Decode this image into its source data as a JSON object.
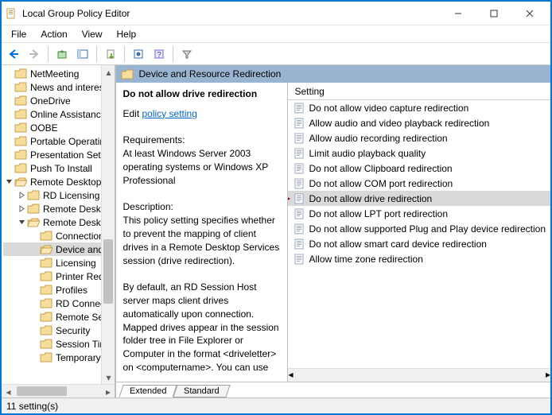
{
  "window": {
    "title": "Local Group Policy Editor"
  },
  "menu": {
    "file": "File",
    "action": "Action",
    "view": "View",
    "help": "Help"
  },
  "group_header": "Device and Resource Redirection",
  "desc": {
    "name": "Do not allow drive redirection",
    "edit_prefix": "Edit ",
    "edit_link": "policy setting ",
    "req_h": "Requirements:",
    "req_body": "At least Windows Server 2003 operating systems or Windows XP Professional",
    "desc_h": "Description:",
    "desc_body1": "This policy setting specifies whether to prevent the mapping of client drives in a Remote Desktop Services session (drive redirection).",
    "desc_body2": "By default, an RD Session Host server maps client drives automatically upon connection. Mapped drives appear in the session folder tree in File Explorer or Computer in the format <driveletter> on <computername>. You can use"
  },
  "list_header": "Setting",
  "settings": [
    "Do not allow video capture redirection",
    "Allow audio and video playback redirection",
    "Allow audio recording redirection",
    "Limit audio playback quality",
    "Do not allow Clipboard redirection",
    "Do not allow COM port redirection",
    "Do not allow drive redirection",
    "Do not allow LPT port redirection",
    "Do not allow supported Plug and Play device redirection",
    "Do not allow smart card device redirection",
    "Allow time zone redirection"
  ],
  "selected_setting_index": 6,
  "tree": [
    {
      "d": 5,
      "e": "",
      "l": "NetMeeting"
    },
    {
      "d": 5,
      "e": "",
      "l": "News and interests"
    },
    {
      "d": 5,
      "e": "",
      "l": "OneDrive"
    },
    {
      "d": 5,
      "e": "",
      "l": "Online Assistance"
    },
    {
      "d": 5,
      "e": "",
      "l": "OOBE"
    },
    {
      "d": 5,
      "e": "",
      "l": "Portable Operating System"
    },
    {
      "d": 5,
      "e": "",
      "l": "Presentation Settings"
    },
    {
      "d": 5,
      "e": "",
      "l": "Push To Install"
    },
    {
      "d": 5,
      "e": "v",
      "l": "Remote Desktop Services"
    },
    {
      "d": 6,
      "e": ">",
      "l": "RD Licensing"
    },
    {
      "d": 6,
      "e": ">",
      "l": "Remote Desktop Connection Client"
    },
    {
      "d": 6,
      "e": "v",
      "l": "Remote Desktop Session Host"
    },
    {
      "d": 7,
      "e": "",
      "l": "Connections"
    },
    {
      "d": 7,
      "e": "",
      "l": "Device and Resource Redirection",
      "sel": true
    },
    {
      "d": 7,
      "e": "",
      "l": "Licensing"
    },
    {
      "d": 7,
      "e": "",
      "l": "Printer Redirection"
    },
    {
      "d": 7,
      "e": "",
      "l": "Profiles"
    },
    {
      "d": 7,
      "e": "",
      "l": "RD Connection Broker"
    },
    {
      "d": 7,
      "e": "",
      "l": "Remote Session Environment"
    },
    {
      "d": 7,
      "e": "",
      "l": "Security"
    },
    {
      "d": 7,
      "e": "",
      "l": "Session Time Limits"
    },
    {
      "d": 7,
      "e": "",
      "l": "Temporary folders"
    }
  ],
  "tabs": {
    "extended": "Extended",
    "standard": "Standard"
  },
  "status": "11 setting(s)"
}
